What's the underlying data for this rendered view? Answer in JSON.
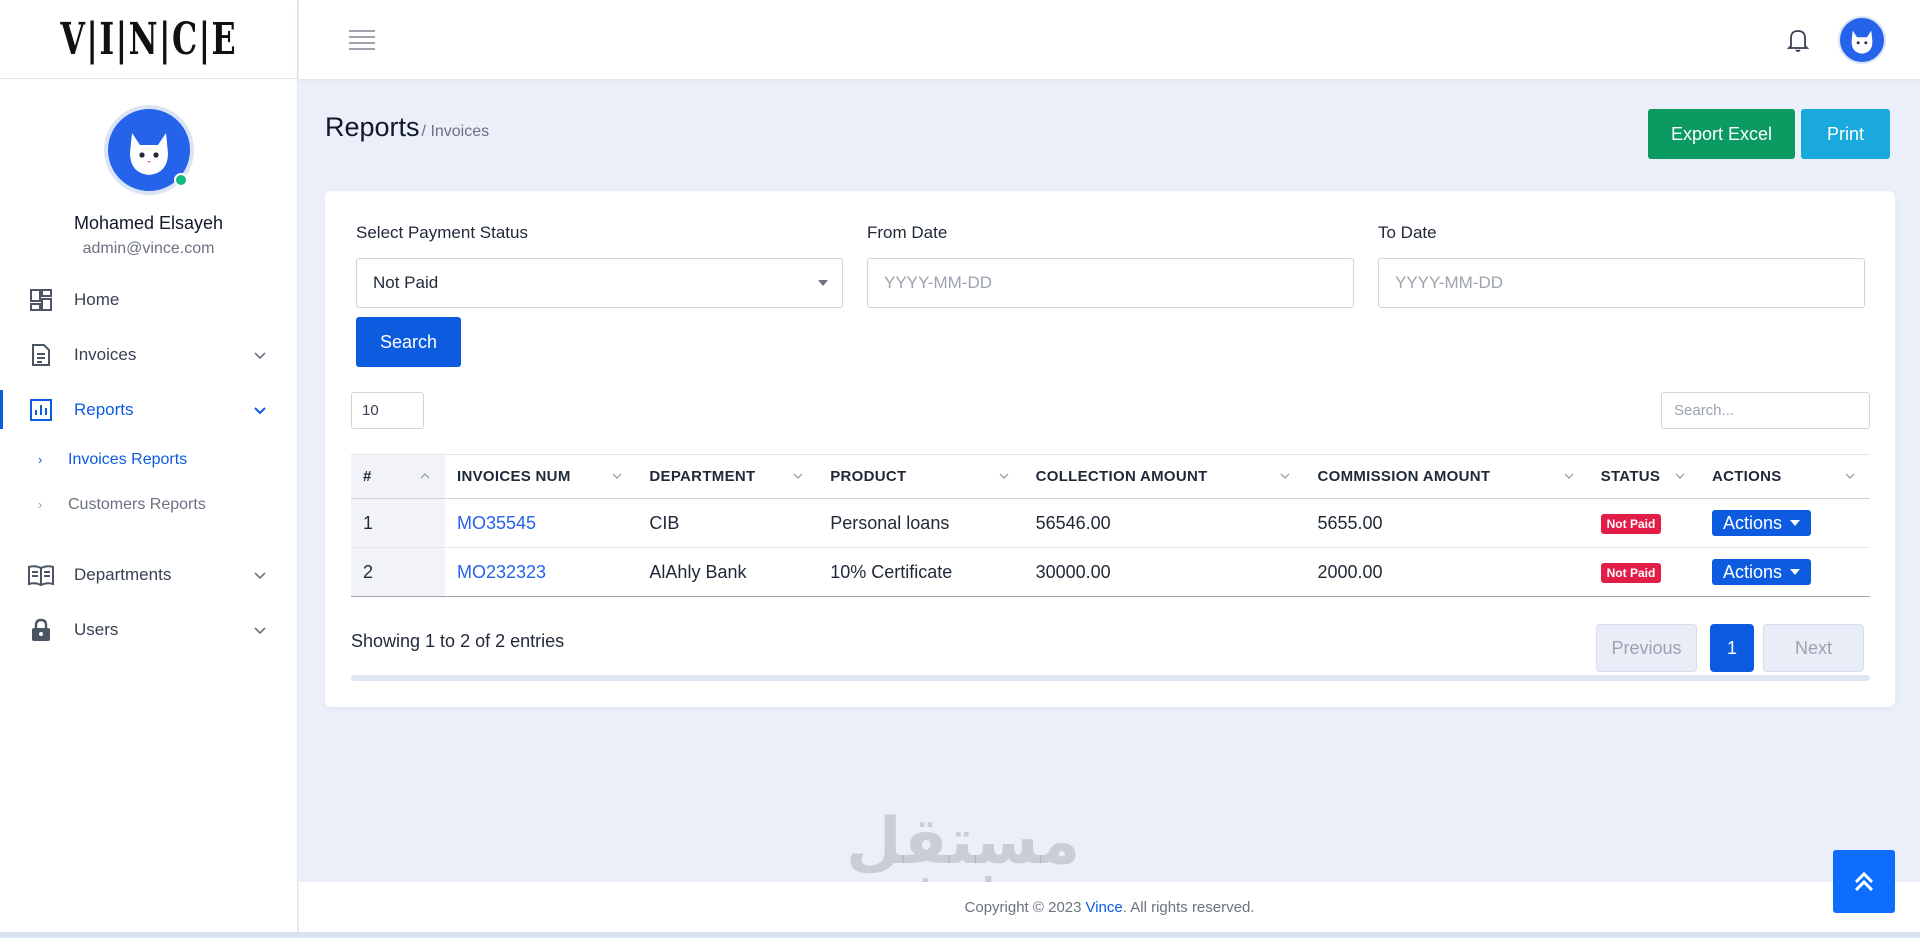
{
  "brand": {
    "logo_text": "VINCE"
  },
  "user": {
    "name": "Mohamed Elsayeh",
    "email": "admin@vince.com"
  },
  "sidebar": {
    "items": [
      {
        "label": "Home",
        "icon": "dashboard-icon",
        "expandable": false
      },
      {
        "label": "Invoices",
        "icon": "document-icon",
        "expandable": true
      },
      {
        "label": "Reports",
        "icon": "bar-chart-icon",
        "expandable": true,
        "active": true,
        "children": [
          {
            "label": "Invoices Reports",
            "active": true
          },
          {
            "label": "Customers Reports",
            "active": false
          }
        ]
      },
      {
        "label": "Departments",
        "icon": "book-icon",
        "expandable": true
      },
      {
        "label": "Users",
        "icon": "lock-icon",
        "expandable": true
      }
    ]
  },
  "page": {
    "title": "Reports",
    "breadcrumb": "/ Invoices",
    "export_label": "Export Excel",
    "print_label": "Print"
  },
  "filters": {
    "status_label": "Select Payment Status",
    "status_value": "Not Paid",
    "from_label": "From Date",
    "from_placeholder": "YYYY-MM-DD",
    "to_label": "To Date",
    "to_placeholder": "YYYY-MM-DD",
    "search_label": "Search"
  },
  "table": {
    "page_length": "10",
    "search_placeholder": "Search...",
    "headers": [
      "#",
      "INVOICES NUM",
      "DEPARTMENT",
      "PRODUCT",
      "COLLECTION AMOUNT",
      "COMMISSION AMOUNT",
      "STATUS",
      "ACTIONS"
    ],
    "rows": [
      {
        "index": "1",
        "invoice": "MO35545",
        "department": "CIB",
        "product": "Personal loans",
        "collection": "56546.00",
        "commission": "5655.00",
        "status": "Not Paid",
        "action": "Actions"
      },
      {
        "index": "2",
        "invoice": "MO232323",
        "department": "AlAhly Bank",
        "product": "10% Certificate",
        "collection": "30000.00",
        "commission": "2000.00",
        "status": "Not Paid",
        "action": "Actions"
      }
    ],
    "info": "Showing 1 to 2 of 2 entries",
    "pagination": {
      "previous": "Previous",
      "current": "1",
      "next": "Next"
    }
  },
  "footer": {
    "prefix": "Copyright © 2023",
    "brand": "Vince",
    "suffix": ". All rights reserved."
  },
  "watermark": {
    "arabic": "مستقل",
    "latin": "mostaql.com"
  },
  "colors": {
    "primary": "#0d5ce0",
    "success": "#0b9a62",
    "info": "#1aa9dc",
    "danger": "#e11d48",
    "background": "#ebeff9"
  }
}
